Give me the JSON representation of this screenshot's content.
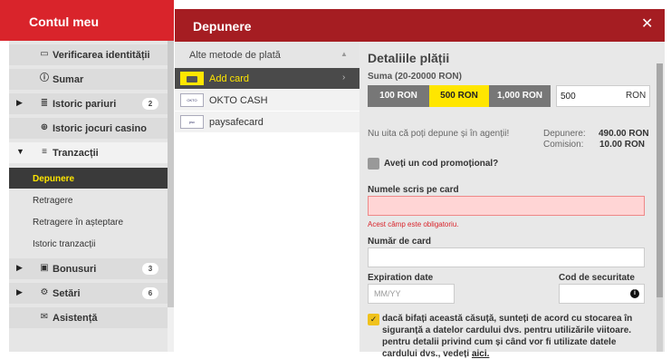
{
  "sidebar": {
    "title": "Contul meu",
    "items": {
      "verify": {
        "label": "Verificarea identității",
        "icon": "id-card-icon"
      },
      "summary": {
        "label": "Sumar",
        "icon": "info-icon"
      },
      "bets": {
        "label": "Istoric pariuri",
        "icon": "receipt-icon",
        "badge": "2"
      },
      "casino": {
        "label": "Istoric jocuri casino",
        "icon": "casino-chip-icon"
      },
      "transactions": {
        "label": "Tranzacții",
        "icon": "transactions-icon"
      },
      "bonuses": {
        "label": "Bonusuri",
        "icon": "gift-icon",
        "badge": "3"
      },
      "settings": {
        "label": "Setări",
        "icon": "settings-icon",
        "badge": "6"
      },
      "support": {
        "label": "Asistență",
        "icon": "mail-icon"
      }
    },
    "sub_items": [
      "Depunere",
      "Retragere",
      "Retragere în așteptare",
      "Istoric tranzacții"
    ]
  },
  "panel": {
    "title": "Depunere"
  },
  "methods": {
    "header": "Alte metode de plată",
    "list": [
      "Add card",
      "OKTO CASH",
      "paysafecard"
    ]
  },
  "details": {
    "title": "Detaliile plății",
    "sum_label": "Suma (20-20000 RON)",
    "amounts": [
      "100 RON",
      "500 RON",
      "1,000 RON"
    ],
    "amount_value": "500",
    "currency": "RON",
    "agency_note": "Nu uita că poți depune și în agenții!",
    "deposit_label": "Depunere:",
    "deposit_value": "490.00 RON",
    "fee_label": "Comision:",
    "fee_value": "10.00 RON",
    "promo_label": "Aveți un cod promoțional?",
    "name_label": "Numele scris pe card",
    "name_error": "Acest câmp este obligatoriu.",
    "card_number_label": "Număr de card",
    "expiry_label": "Expiration date",
    "expiry_placeholder": "MM/YY",
    "cvv_label": "Cod de securitate",
    "terms_text": "dacă bifați această căsuță, sunteți de acord cu stocarea în siguranță a datelor cardului dvs. pentru utilizările viitoare. pentru detalii privind cum și când vor fi utilizate datele cardului dvs., vedeți",
    "terms_link": "aici."
  },
  "colors": {
    "brand_red": "#d9242b",
    "header_dark_red": "#a51d22",
    "accent_yellow": "#ffe600"
  }
}
